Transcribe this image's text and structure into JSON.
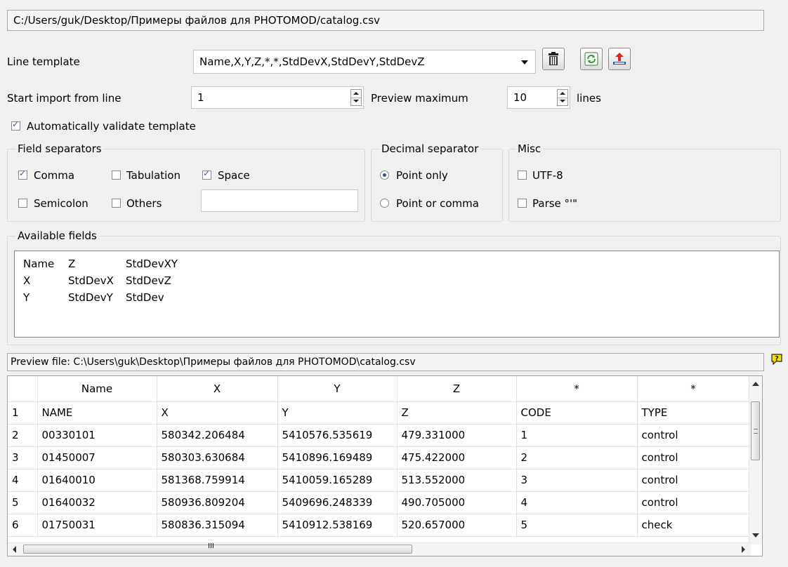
{
  "file_path": "C:/Users/guk/Desktop/Примеры файлов для PHOTOMOD/catalog.csv",
  "line_template": {
    "label": "Line template",
    "value": "Name,X,Y,Z,*,*,StdDevX,StdDevY,StdDevZ"
  },
  "start_import": {
    "label": "Start import from line",
    "value": "1"
  },
  "preview_maximum": {
    "label": "Preview maximum",
    "value": "10",
    "suffix": "lines"
  },
  "auto_validate": {
    "label": "Automatically validate template",
    "checked": true
  },
  "field_separators": {
    "title": "Field separators",
    "comma": {
      "label": "Comma",
      "checked": true
    },
    "tabulation": {
      "label": "Tabulation",
      "checked": false
    },
    "space": {
      "label": "Space",
      "checked": true
    },
    "semicolon": {
      "label": "Semicolon",
      "checked": false
    },
    "others": {
      "label": "Others",
      "checked": false,
      "value": ""
    }
  },
  "decimal_separator": {
    "title": "Decimal separator",
    "point_only": {
      "label": "Point only",
      "selected": true
    },
    "point_or_comma": {
      "label": "Point or comma",
      "selected": false
    }
  },
  "misc": {
    "title": "Misc",
    "utf8": {
      "label": "UTF-8",
      "checked": false
    },
    "parse": {
      "label": "Parse °'\"",
      "checked": false
    }
  },
  "available_fields": {
    "title": "Available fields",
    "columns": [
      [
        "Name",
        "X",
        "Y"
      ],
      [
        "Z",
        "StdDevX",
        "StdDevY"
      ],
      [
        "StdDevXY",
        "StdDevZ",
        "StdDev"
      ]
    ]
  },
  "preview": {
    "label": "Preview file: C:\\Users\\guk\\Desktop\\Примеры файлов для PHOTOMOD\\catalog.csv",
    "headers": [
      "",
      "Name",
      "X",
      "Y",
      "Z",
      "*",
      "*"
    ],
    "rows": [
      [
        "1",
        "NAME",
        "X",
        "Y",
        "Z",
        "CODE",
        "TYPE"
      ],
      [
        "2",
        "00330101",
        "580342.206484",
        "5410576.535619",
        "479.331000",
        "1",
        "control"
      ],
      [
        "3",
        "01450007",
        "580303.630684",
        "5410896.169489",
        "475.422000",
        "2",
        "control"
      ],
      [
        "4",
        "01640010",
        "581368.759914",
        "5410059.165289",
        "513.552000",
        "3",
        "control"
      ],
      [
        "5",
        "01640032",
        "580936.809204",
        "5409696.248339",
        "490.705000",
        "4",
        "control"
      ],
      [
        "6",
        "01750031",
        "580836.315094",
        "5410912.538169",
        "520.657000",
        "5",
        "check"
      ]
    ],
    "hscroll_glyph": "III"
  },
  "icons": {
    "delete": "trash-icon",
    "refresh": "refresh-icon",
    "save": "upload-icon",
    "help": "help-icon"
  },
  "colors": {
    "accent": "#2a56a6",
    "help_icon": "#f5e100"
  }
}
